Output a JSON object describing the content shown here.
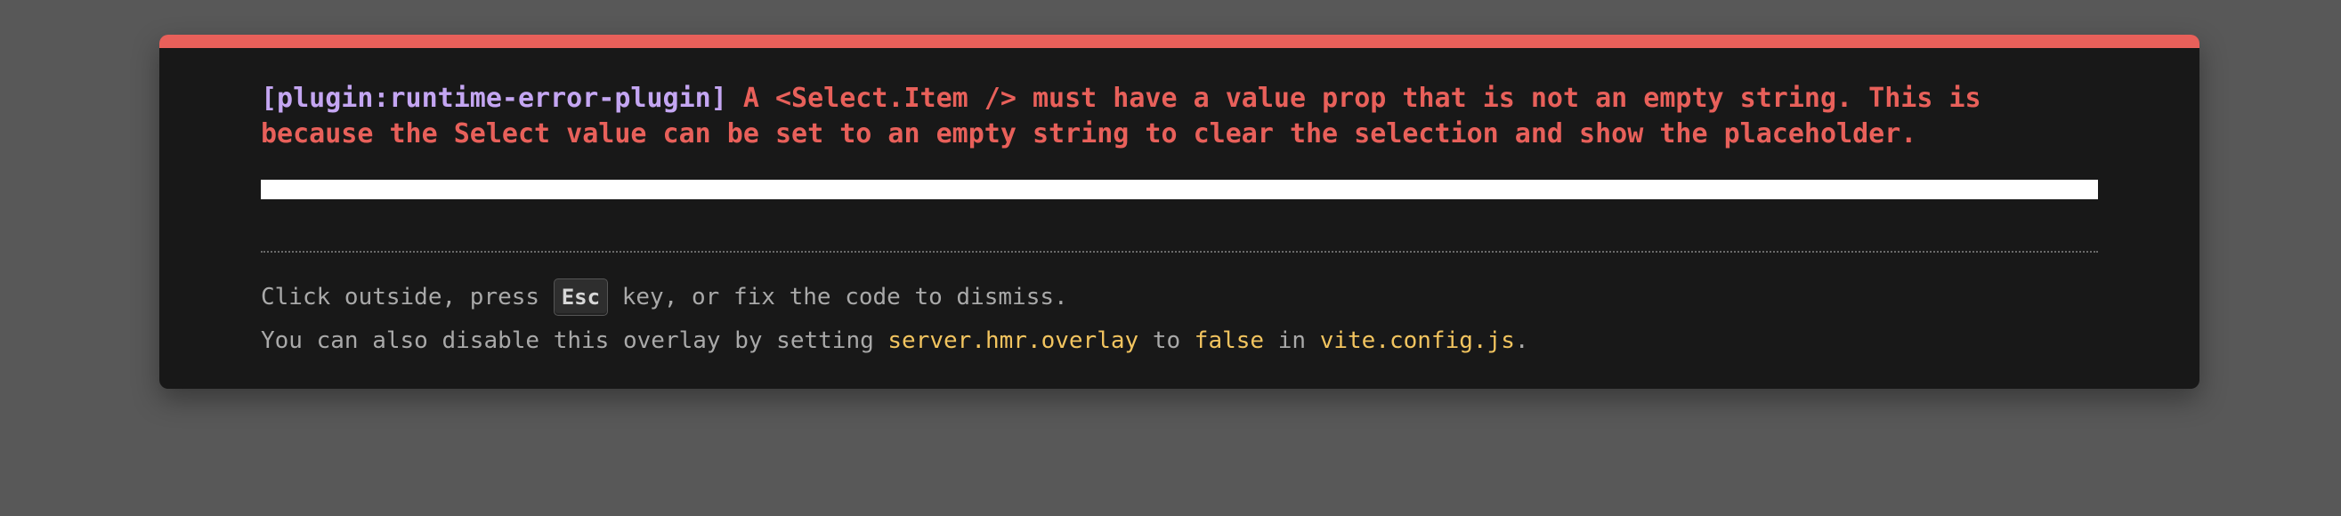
{
  "error": {
    "plugin": "[plugin:runtime-error-plugin]",
    "message": "A <Select.Item /> must have a value prop that is not an empty string. This is because the Select value can be set to an empty string to clear the selection and show the placeholder."
  },
  "tip_dismiss": {
    "before": "Click outside, press ",
    "key": "Esc",
    "after": " key, or fix the code to dismiss."
  },
  "tip_disable": {
    "t1": "You can also disable this overlay by setting ",
    "code1": "server.hmr.overlay",
    "t2": " to ",
    "code2": "false",
    "t3": " in ",
    "code3": "vite.config.js",
    "t4": "."
  },
  "colors": {
    "accent_red": "#e8605a",
    "plugin_purple": "#c4a6f2",
    "code_yellow": "#f2c45f",
    "backdrop": "#585858",
    "window_bg": "#181818"
  }
}
